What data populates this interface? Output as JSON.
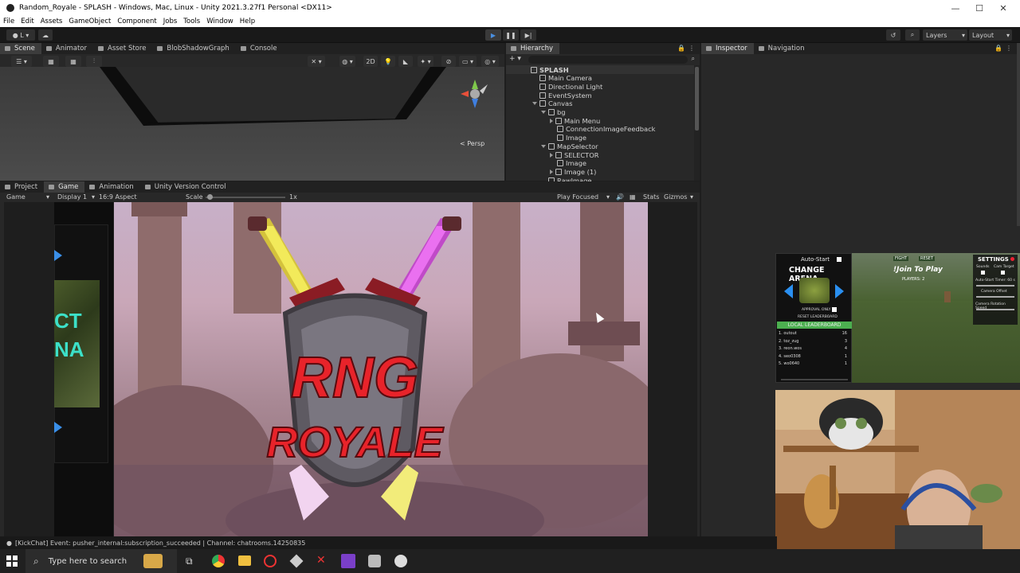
{
  "window": {
    "title": "Random_Royale - SPLASH - Windows, Mac, Linux - Unity 2021.3.27f1 Personal <DX11>",
    "minimize": "—",
    "maximize": "☐",
    "close": "✕"
  },
  "menu": [
    "File",
    "Edit",
    "Assets",
    "GameObject",
    "Component",
    "Jobs",
    "Tools",
    "Window",
    "Help"
  ],
  "toolbar": {
    "layers_label": "Layers",
    "layout_label": "Layout"
  },
  "scene_tabs": [
    "Scene",
    "Animator",
    "Asset Store",
    "BlobShadowGraph",
    "Console"
  ],
  "scene": {
    "mode_2d": "2D",
    "persp_label": "< Persp"
  },
  "hierarchy": {
    "tab_label": "Hierarchy",
    "add_label": "+ ▾",
    "items": [
      {
        "label": "SPLASH",
        "depth": 0,
        "type": "scene"
      },
      {
        "label": "Main Camera",
        "depth": 1,
        "type": "obj"
      },
      {
        "label": "Directional Light",
        "depth": 1,
        "type": "obj"
      },
      {
        "label": "EventSystem",
        "depth": 1,
        "type": "obj"
      },
      {
        "label": "Canvas",
        "depth": 1,
        "type": "obj",
        "expanded": true
      },
      {
        "label": "bg",
        "depth": 2,
        "type": "obj",
        "expanded": true
      },
      {
        "label": "Main Menu",
        "depth": 3,
        "type": "obj",
        "collapsed": true
      },
      {
        "label": "ConnectionImageFeedback",
        "depth": 3,
        "type": "obj"
      },
      {
        "label": "Image",
        "depth": 3,
        "type": "obj"
      },
      {
        "label": "MapSelector",
        "depth": 2,
        "type": "obj",
        "expanded": true
      },
      {
        "label": "SELECTOR",
        "depth": 3,
        "type": "obj",
        "collapsed": true
      },
      {
        "label": "Image",
        "depth": 3,
        "type": "obj"
      },
      {
        "label": "Image (1)",
        "depth": 3,
        "type": "obj",
        "collapsed": true
      },
      {
        "label": "RawImage",
        "depth": 2,
        "type": "obj"
      }
    ]
  },
  "inspector_tabs": [
    "Inspector",
    "Navigation"
  ],
  "game_tabs": [
    "Project",
    "Game",
    "Animation",
    "Unity Version Control"
  ],
  "game_toolbar": {
    "game_label": "Game",
    "display": "Display 1",
    "aspect": "16:9 Aspect",
    "scale_label": "Scale",
    "scale_value": "1x",
    "play_focused": "Play Focused",
    "stats": "Stats",
    "gizmos": "Gizmos"
  },
  "game": {
    "left_text_line1": "CT",
    "left_text_line2": "NA",
    "logo_line1": "RNG",
    "logo_line2": "ROYALE"
  },
  "overlay": {
    "auto_start": "Auto-Start",
    "change_arena": "CHANGE ARENA",
    "approval": "APPROVAL ONLY",
    "reset_leaderboard": "RESET LEADERBOARD",
    "local_leaderboard": "LOCAL LEADERBOARD",
    "leaderboard": [
      {
        "rank": "1. outout",
        "score": "16"
      },
      {
        "rank": "2. toz_zug",
        "score": "3"
      },
      {
        "rank": "3. reon.wos",
        "score": "4"
      },
      {
        "rank": "4. seo0308",
        "score": "1"
      },
      {
        "rank": "5. wo0640",
        "score": "1"
      }
    ],
    "join": "!Join To Play",
    "players": "PLAYERS: 2",
    "fight": "FIGHT",
    "reset": "RESET",
    "settings_title": "SETTINGS",
    "sounds": "Sounds",
    "cam_target": "Cam Target",
    "auto_start_timer": "Auto-Start Timer: 60 s",
    "camera_offset": "Camera Offset",
    "camera_rotation_speed": "Camera Rotation Speed"
  },
  "status": {
    "text": "[KickChat] Event: pusher_internal:subscription_succeeded | Channel: chatrooms.14250835"
  },
  "taskbar": {
    "search_placeholder": "Type here to search"
  },
  "colors": {
    "title_bg": "#ffffff",
    "editor_bg": "#282828",
    "play_blue": "#4a8fe0",
    "logo_red": "#e8232a",
    "leaderboard_green": "#4caf50",
    "taskbar": "#202020"
  }
}
